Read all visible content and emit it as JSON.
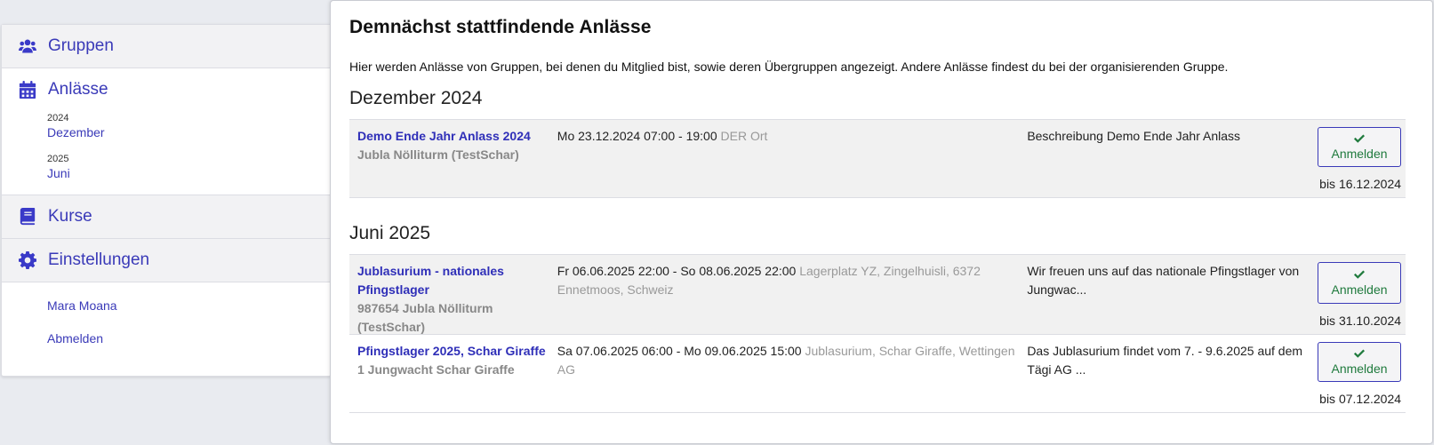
{
  "sidebar": {
    "groups_label": "Gruppen",
    "events_label": "Anlässe",
    "years": [
      {
        "year": "2024",
        "month": "Dezember"
      },
      {
        "year": "2025",
        "month": "Juni"
      }
    ],
    "courses_label": "Kurse",
    "settings_label": "Einstellungen",
    "user_name": "Mara Moana",
    "logout_label": "Abmelden"
  },
  "main": {
    "title": "Demnächst stattfindende Anlässe",
    "intro": "Hier werden Anlässe von Gruppen, bei denen du Mitglied bist, sowie deren Übergruppen angezeigt. Andere Anlässe findest du bei der organisierenden Gruppe.",
    "sections": [
      {
        "heading": "Dezember 2024",
        "events": [
          {
            "name": "Demo Ende Jahr Anlass 2024",
            "group": "Jubla Nölliturm (TestSchar)",
            "dates": "Mo 23.12.2024 07:00 - 19:00",
            "location": "DER Ort",
            "description": "Beschreibung Demo Ende Jahr Anlass",
            "button": "Anmelden",
            "deadline": "bis 16.12.2024"
          }
        ]
      },
      {
        "heading": "Juni 2025",
        "events": [
          {
            "name": "Jublasurium - nationales Pfingstlager",
            "group": "987654 Jubla Nölliturm (TestSchar)",
            "dates": "Fr 06.06.2025 22:00 - So 08.06.2025 22:00",
            "location": "Lagerplatz YZ, Zingelhuisli, 6372 Ennetmoos, Schweiz",
            "description": "Wir freuen uns auf das nationale Pfingstlager von Jungwac...",
            "button": "Anmelden",
            "deadline": "bis 31.10.2024"
          },
          {
            "name": "Pfingstlager 2025, Schar Giraffe",
            "group": "1 Jungwacht Schar Giraffe",
            "dates": "Sa 07.06.2025 06:00 - Mo 09.06.2025 15:00",
            "location": "Jublasurium, Schar Giraffe, Wettingen AG",
            "description": "Das Jublasurium findet vom 7. - 9.6.2025 auf dem Tägi AG ...",
            "button": "Anmelden",
            "deadline": "bis 07.12.2024"
          }
        ]
      }
    ]
  },
  "colors": {
    "accent": "#3a3ab8",
    "success": "#1f7a3d"
  },
  "icons": {
    "groups": "users-icon",
    "events": "calendar-icon",
    "courses": "book-icon",
    "settings": "gear-icon",
    "signup": "check-icon"
  }
}
